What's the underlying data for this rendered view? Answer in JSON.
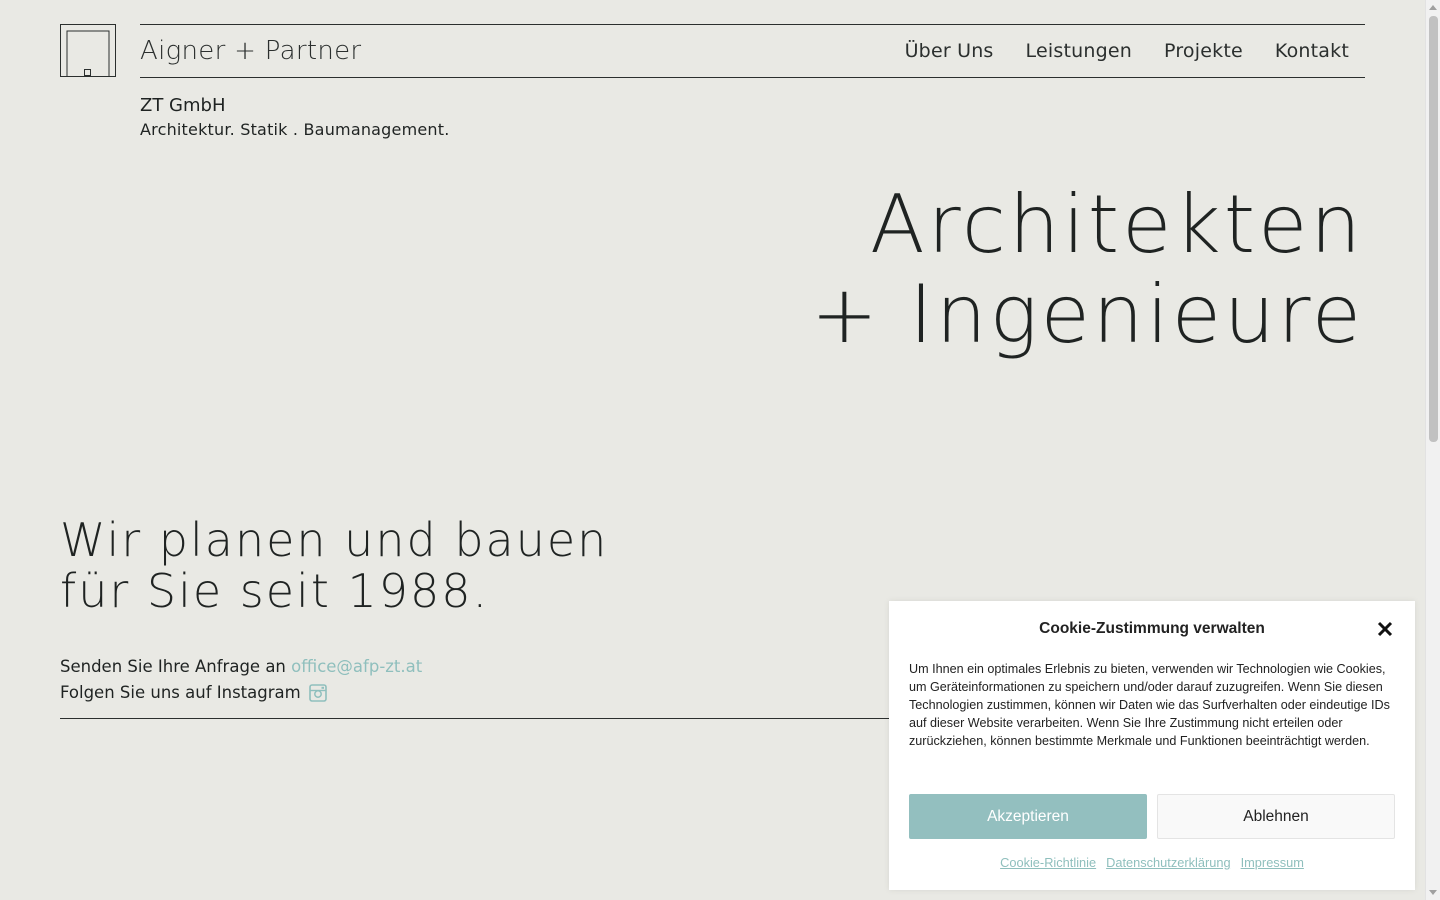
{
  "header": {
    "brand": "Aigner + Partner",
    "nav": [
      "Über Uns",
      "Leistungen",
      "Projekte",
      "Kontakt"
    ]
  },
  "company": {
    "name": "ZT GmbH",
    "tagline": "Architektur. Statik . Baumanagement."
  },
  "hero": {
    "line1": "Architekten",
    "line2": "+ Ingenieure"
  },
  "intro": {
    "line1": "Wir planen und bauen",
    "line2": "für Sie seit 1988."
  },
  "contact": {
    "request_text": "Senden Sie Ihre Anfrage an",
    "email": "office@afp-zt.at",
    "instagram_text": "Folgen Sie uns auf Instagram",
    "instagram_icon": "instagram-icon"
  },
  "cookie": {
    "title": "Cookie-Zustimmung verwalten",
    "body": "Um Ihnen ein optimales Erlebnis zu bieten, verwenden wir Technologien wie Cookies, um Geräteinformationen zu speichern und/oder darauf zuzugreifen. Wenn Sie diesen Technologien zustimmen, können wir Daten wie das Surfverhalten oder eindeutige IDs auf dieser Website verarbeiten. Wenn Sie Ihre Zustimmung nicht erteilen oder zurückziehen, können bestimmte Merkmale und Funktionen beeinträchtigt werden.",
    "accept": "Akzeptieren",
    "deny": "Ablehnen",
    "links": [
      "Cookie-Richtlinie",
      "Datenschutzerklärung",
      "Impressum"
    ]
  },
  "colors": {
    "background": "#e9e9e4",
    "text": "#1f2322",
    "accent": "#93bfbf"
  }
}
